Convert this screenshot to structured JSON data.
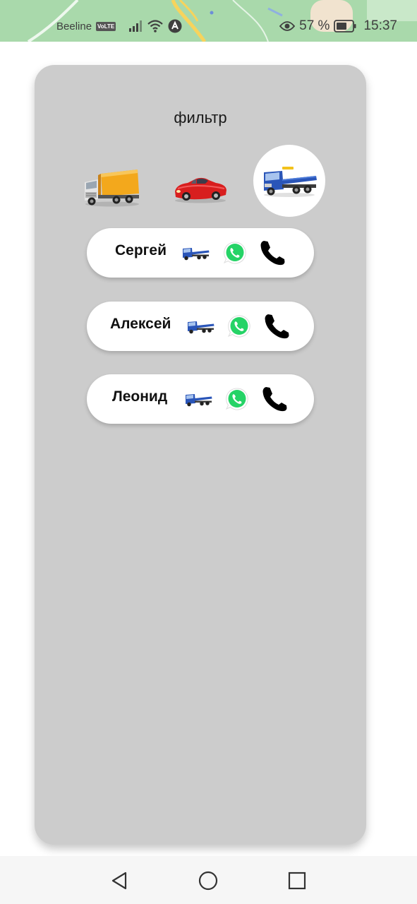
{
  "status_bar": {
    "carrier": "Beeline",
    "network_badge": "VoLTE",
    "battery_percent": "57 %",
    "time": "15:37",
    "icons": [
      "signal-icon",
      "wifi-icon",
      "nfc-icon",
      "eye-icon",
      "battery-icon"
    ]
  },
  "filter": {
    "title": "фильтр",
    "vehicles": [
      {
        "icon": "box-truck-icon",
        "selected": false
      },
      {
        "icon": "sports-car-icon",
        "selected": false
      },
      {
        "icon": "tow-truck-icon",
        "selected": true
      }
    ]
  },
  "contacts": [
    {
      "name": "Сергей",
      "vehicle_icon": "tow-truck-icon",
      "messenger_icon": "whatsapp-icon",
      "call_icon": "phone-icon"
    },
    {
      "name": "Алексей",
      "vehicle_icon": "tow-truck-icon",
      "messenger_icon": "whatsapp-icon",
      "call_icon": "phone-icon"
    },
    {
      "name": "Леонид",
      "vehicle_icon": "tow-truck-icon",
      "messenger_icon": "whatsapp-icon",
      "call_icon": "phone-icon"
    }
  ],
  "nav_bar": {
    "buttons": [
      "back-icon",
      "home-icon",
      "recents-icon"
    ]
  },
  "colors": {
    "card_background": "#cccccc",
    "status_bar_map": "#a8d8a8",
    "whatsapp_green": "#25d366",
    "truck_blue": "#2a55b8",
    "truck_orange": "#f3a81c",
    "car_red": "#d81e1e"
  }
}
